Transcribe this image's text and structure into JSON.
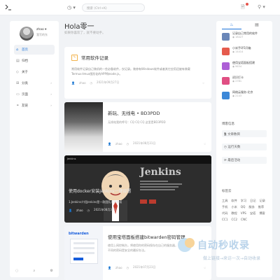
{
  "topbar": {
    "search_placeholder": "搜索 (Ctrl+K)"
  },
  "profile": {
    "name": "zhao",
    "subtitle": "我写的东"
  },
  "nav": [
    {
      "label": "首页",
      "icon": "home-icon",
      "arrow": ""
    },
    {
      "label": "归档",
      "icon": "archive-icon",
      "arrow": ""
    },
    {
      "label": "关于",
      "icon": "info-icon",
      "arrow": ""
    },
    {
      "label": "分类",
      "icon": "category-icon",
      "arrow": "›"
    },
    {
      "label": "页面",
      "icon": "page-icon",
      "arrow": "›"
    },
    {
      "label": "友链",
      "icon": "link-icon",
      "arrow": "›"
    }
  ],
  "hero": {
    "title": "Hola零一",
    "subtitle": "如果你喜欢了，就不要动手。"
  },
  "posts": [
    {
      "title": "常用软件记录",
      "excerpt": "常用软件记录自己装机的一些必备软件，仅记录。装修有Windows软件或者其它应用还被有装载Termux:tmux图形化的APP和node.js。",
      "author": "zhao",
      "date": "2021年09月27日"
    },
    {
      "title": "新玩、无线电 • BD3PDD",
      "excerpt": "无线电我的呼号：CQ CQ CQ 这里是BD3PDD",
      "author": "zhao",
      "date": "2021年08月31日"
    },
    {
      "title": "使用docker安装jenkins一键部署",
      "excerpt": "1.Jenkins介绍Jenkins是一款团队开源持续",
      "author": "zhao",
      "date": "2021年08月30日",
      "image_heading": "Jenkins",
      "image_bar": "Jenkins"
    },
    {
      "title": "使用宝塔面板搭建bitwarden密码管理",
      "excerpt": "使用上网控制台，将使用你的密码保存在自己的服务器，使用不同的密码是安全的最好办法。",
      "author": "zhao",
      "date": "2021年07月23日",
      "brand": "bitwarden"
    }
  ],
  "right": {
    "tabs": [
      "热门",
      "最新"
    ],
    "hot": [
      {
        "title": "记录自己常用的软件",
        "views": "18427",
        "color": "#6a87b8"
      },
      {
        "title": "小米手环5开箱",
        "views": "14414",
        "color": "#e55b4d"
      },
      {
        "title": "使用宝塔面板搭建",
        "views": "9634",
        "color": "#ad5fd6"
      },
      {
        "title": "初识打卡",
        "views": "2781",
        "color": "#e04f83"
      },
      {
        "title": "网络云服务-北京",
        "views": "2143",
        "color": "#3c88d8"
      }
    ],
    "stats_title": "博客信息",
    "stats": [
      "文章数目",
      "运行天数",
      "最后活动"
    ],
    "tags_title": "标签云",
    "tags": [
      "工具",
      "软件",
      "学习",
      "日记",
      "记录",
      "手机",
      "小米",
      "QQ",
      "服务",
      "推荐",
      "代码",
      "教程",
      "VPS",
      "宝塔",
      "博客",
      "CC1",
      "CC2",
      "CNC"
    ]
  },
  "watermark": {
    "text": "自动秒收录",
    "sub": "做上链接→来访一次→自动收录"
  }
}
